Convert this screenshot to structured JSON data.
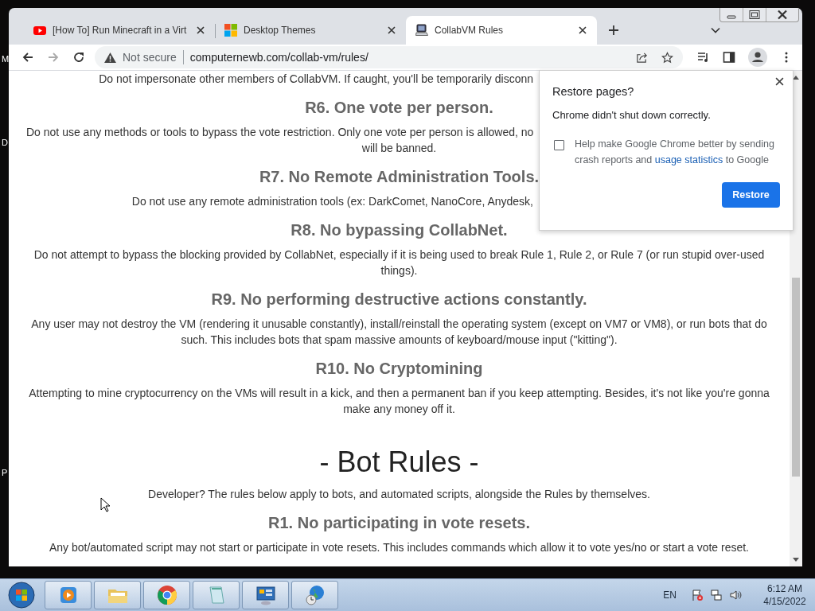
{
  "desktop": {
    "icon_labels": [
      "M",
      "D",
      "P"
    ]
  },
  "tabs": [
    {
      "title": "[How To] Run Minecraft in a Virt",
      "selected": false
    },
    {
      "title": "Desktop Themes",
      "selected": false
    },
    {
      "title": "CollabVM Rules",
      "selected": true
    }
  ],
  "toolbar": {
    "security": "Not secure",
    "url": "computernewb.com/collab-vm/rules/"
  },
  "page": {
    "blocks": [
      {
        "kind": "text",
        "text": "Do not impersonate other members of CollabVM. If caught, you'll be temporarily disconn",
        "hidden_right": true
      },
      {
        "kind": "heading",
        "text": "R6. One vote per person."
      },
      {
        "kind": "text",
        "text": "Do not use any methods or tools to bypass the vote restriction. Only one vote per person is allowed, no",
        "hidden_right": true
      },
      {
        "kind": "text",
        "text": "will be banned.",
        "hidden_right": false
      },
      {
        "kind": "heading",
        "text": "R7. No Remote Administration Tools."
      },
      {
        "kind": "text",
        "text": "Do not use any remote administration tools (ex: DarkComet, NanoCore, Anydesk,",
        "hidden_right": true
      },
      {
        "kind": "heading",
        "text": "R8. No bypassing CollabNet."
      },
      {
        "kind": "text",
        "text": "Do not attempt to bypass the blocking provided by CollabNet, especially if it is being used to break Rule 1, Rule 2, or Rule 7 (or run stupid over-used things).",
        "hidden_right": false
      },
      {
        "kind": "heading",
        "text": "R9. No performing destructive actions constantly."
      },
      {
        "kind": "text",
        "text": "Any user may not destroy the VM (rendering it unusable constantly), install/reinstall the operating system (except on VM7 or VM8), or run bots that do such. This includes bots that spam massive amounts of keyboard/mouse input (\"kitting\").",
        "hidden_right": false
      },
      {
        "kind": "heading",
        "text": "R10. No Cryptomining"
      },
      {
        "kind": "text",
        "text": "Attempting to mine cryptocurrency on the VMs will result in a kick, and then a permanent ban if you keep attempting. Besides, it's not like you're gonna make any money off it.",
        "hidden_right": false
      },
      {
        "kind": "title",
        "text": "- Bot Rules -"
      },
      {
        "kind": "text",
        "text": "Developer? The rules below apply to bots, and automated scripts, alongside the Rules by themselves.",
        "hidden_right": false
      },
      {
        "kind": "heading",
        "text": "R1. No participating in vote resets."
      },
      {
        "kind": "text",
        "text": "Any bot/automated script may not start or participate in vote resets. This includes commands which allow it to vote yes/no or start a vote reset.",
        "hidden_right": false
      }
    ]
  },
  "popup": {
    "title": "Restore pages?",
    "message": "Chrome didn't shut down correctly.",
    "checkbox": {
      "checked": false,
      "text_before": "Help make Google Chrome better by sending crash reports and ",
      "link": "usage statistics",
      "text_after": " to Google"
    },
    "button": "Restore"
  },
  "taskbar": {
    "language": "EN",
    "time": "6:12 AM",
    "date": "4/15/2022"
  }
}
